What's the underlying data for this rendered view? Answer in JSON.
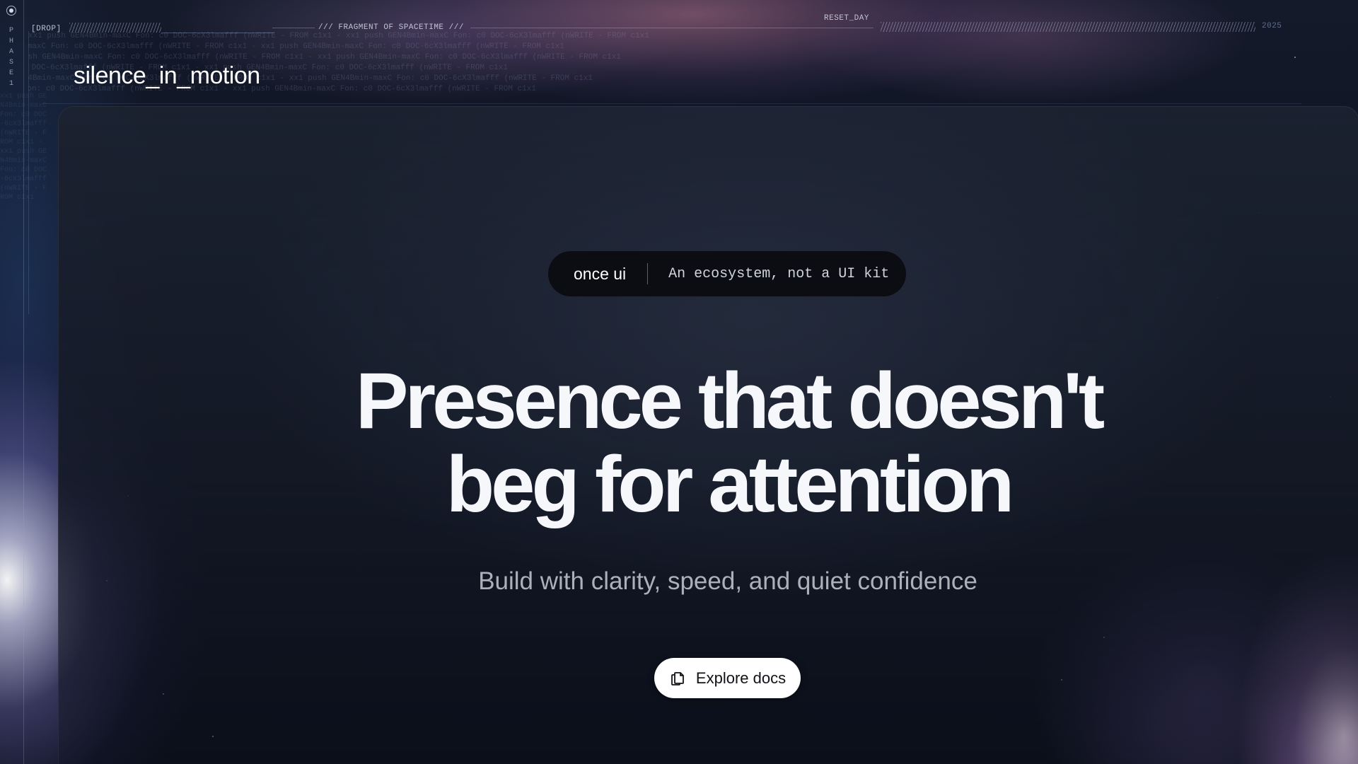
{
  "hud": {
    "drop_tag": "[DROP]",
    "fragment_label": "/// FRAGMENT OF SPACETIME ///",
    "reset_label": "RESET_DAY",
    "year": "2025",
    "phase_letters": [
      "P",
      "H",
      "A",
      "S",
      "E",
      "1"
    ]
  },
  "brand": {
    "name": "silence_in_motion"
  },
  "badge": {
    "brand": "once ui",
    "tagline": "An ecosystem, not a UI kit"
  },
  "hero": {
    "headline_line1": "Presence that doesn't",
    "headline_line2": "beg for attention",
    "subheadline": "Build with clarity, speed, and quiet confidence"
  },
  "cta": {
    "label": "Explore docs",
    "icon": "docs-icon"
  },
  "code_backdrop": "xx1 push GEN4Bmin-maxC Fon: c0 DOC-6cX3lmafff (nWRITE - FROM c1x1 - xx1 push GEN4Bmin-maxC Fon: c0 DOC-6cX3lmafff (nWRITE - FROM c1x1",
  "colors": {
    "background": "#0a0e17",
    "panel": "#1c2230",
    "pill": "#0b0d13",
    "cta_bg": "#ffffff",
    "headline": "#f6f7fa"
  }
}
